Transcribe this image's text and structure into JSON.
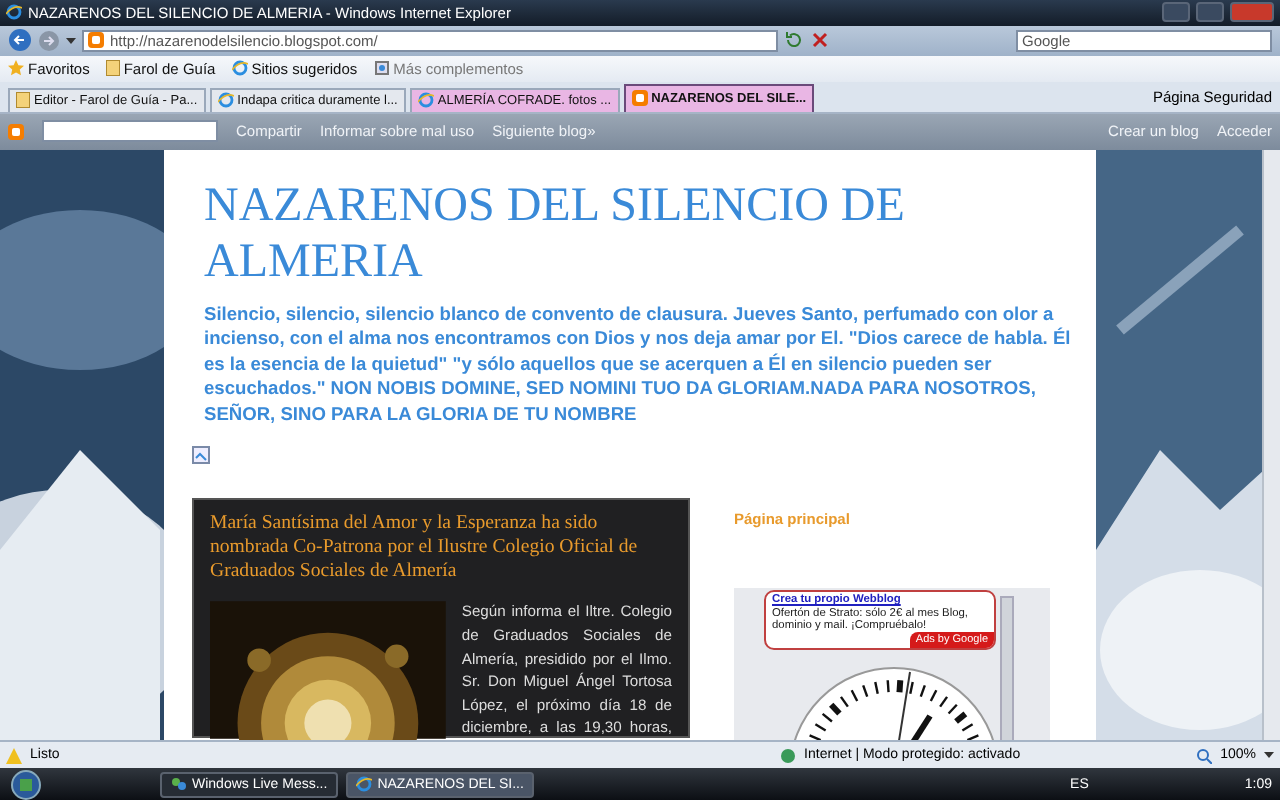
{
  "window": {
    "title": "NAZARENOS DEL SILENCIO DE ALMERIA - Windows Internet Explorer"
  },
  "address_bar": {
    "url": "http://nazarenodelsilencio.blogspot.com/"
  },
  "search": {
    "placeholder": "Google"
  },
  "favorites_bar": {
    "items": [
      {
        "label": "Favoritos",
        "kind": "star"
      },
      {
        "label": "Farol de Guía",
        "kind": "page"
      },
      {
        "label": "Sitios sugeridos",
        "kind": "ie"
      },
      {
        "label": "Más complementos",
        "kind": "addon"
      }
    ]
  },
  "tabs": [
    {
      "label": "Editor - Farol de Guía - Pa...",
      "selected": false,
      "color": "#e4e8ee"
    },
    {
      "label": "Indapa critica duramente l...",
      "selected": false,
      "color": "#e4e8ee"
    },
    {
      "label": "ALMERÍA COFRADE. fotos ...",
      "selected": false,
      "color": "#e9b6e4"
    },
    {
      "label": "NAZARENOS DEL SILE...",
      "selected": true,
      "color": "#e9b6e4"
    }
  ],
  "command_bar": [
    "Página",
    "Seguridad"
  ],
  "blogger_nav": {
    "left": [
      "Compartir",
      "Informar sobre mal uso",
      "Siguiente blog»"
    ],
    "right": [
      "Crear un blog",
      "Acceder"
    ]
  },
  "blog": {
    "title": "NAZARENOS DEL SILENCIO DE ALMERIA",
    "description": "Silencio, silencio, silencio blanco de convento de clausura. Jueves Santo, perfumado con olor a incienso, con el alma nos encontramos con Dios y nos deja amar por El. \"Dios carece de habla. Él es la esencia de la quietud\" \"y sólo aquellos que se acerquen a Él en silencio pueden ser escuchados.\" NON NOBIS DOMINE, SED NOMINI TUO DA GLORIAM.NADA PARA NOSOTROS, SEÑOR, SINO PARA LA GLORIA DE TU NOMBRE"
  },
  "post": {
    "title": "María Santísima del Amor y la Esperanza ha sido nombrada Co-Patrona por el Ilustre Colegio Oficial de Graduados Sociales de Almería",
    "body_lines": [
      "Según informa el Iltre. Colegio",
      "de Graduados Sociales de",
      "Almería, presidido por el Ilmo.",
      "Sr. Don Miguel Ángel Tortosa",
      "López, el próximo día 18 de",
      "diciembre, a las 19,30 horas,"
    ]
  },
  "sidebar": {
    "link": "Página principal",
    "ad": {
      "title": "Crea tu propio Webblog",
      "text": "Ofertón de Strato: sólo 2€ al mes Blog, dominio y mail. ¡Compruébalo!",
      "badge": "Ads by Google"
    }
  },
  "status_bar": {
    "status": "Listo",
    "zone": "Internet | Modo protegido: activado",
    "zoom": "100%"
  },
  "taskbar": {
    "buttons": [
      {
        "label": "Windows Live Mess...",
        "selected": false
      },
      {
        "label": "NAZARENOS DEL SI...",
        "selected": true
      }
    ],
    "language": "ES",
    "time": "1:09"
  }
}
